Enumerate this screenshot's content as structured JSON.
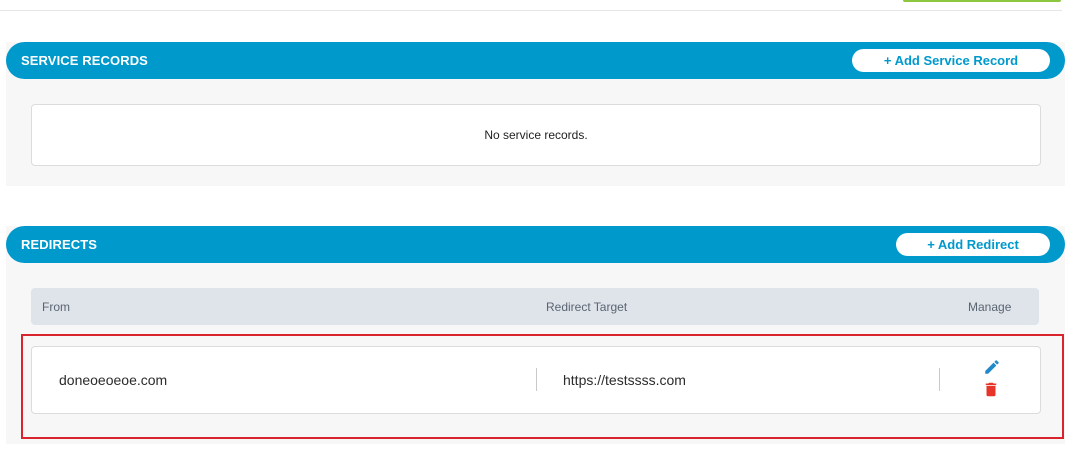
{
  "service_records": {
    "title": "SERVICE RECORDS",
    "add_button_label": "+ Add Service Record",
    "empty_message": "No service records."
  },
  "redirects": {
    "title": "REDIRECTS",
    "add_button_label": "+ Add Redirect",
    "columns": [
      "From",
      "Redirect Target",
      "Manage"
    ],
    "rows": [
      {
        "from": "doneoeoeoe.com",
        "target": "https://testssss.com"
      }
    ]
  },
  "icons": {
    "edit": "pencil-icon",
    "delete": "trash-icon"
  },
  "colors": {
    "header_bg": "#0099cc",
    "edit_icon": "#1f89c9",
    "delete_icon": "#e8352b",
    "highlight_border": "#d9232d"
  }
}
